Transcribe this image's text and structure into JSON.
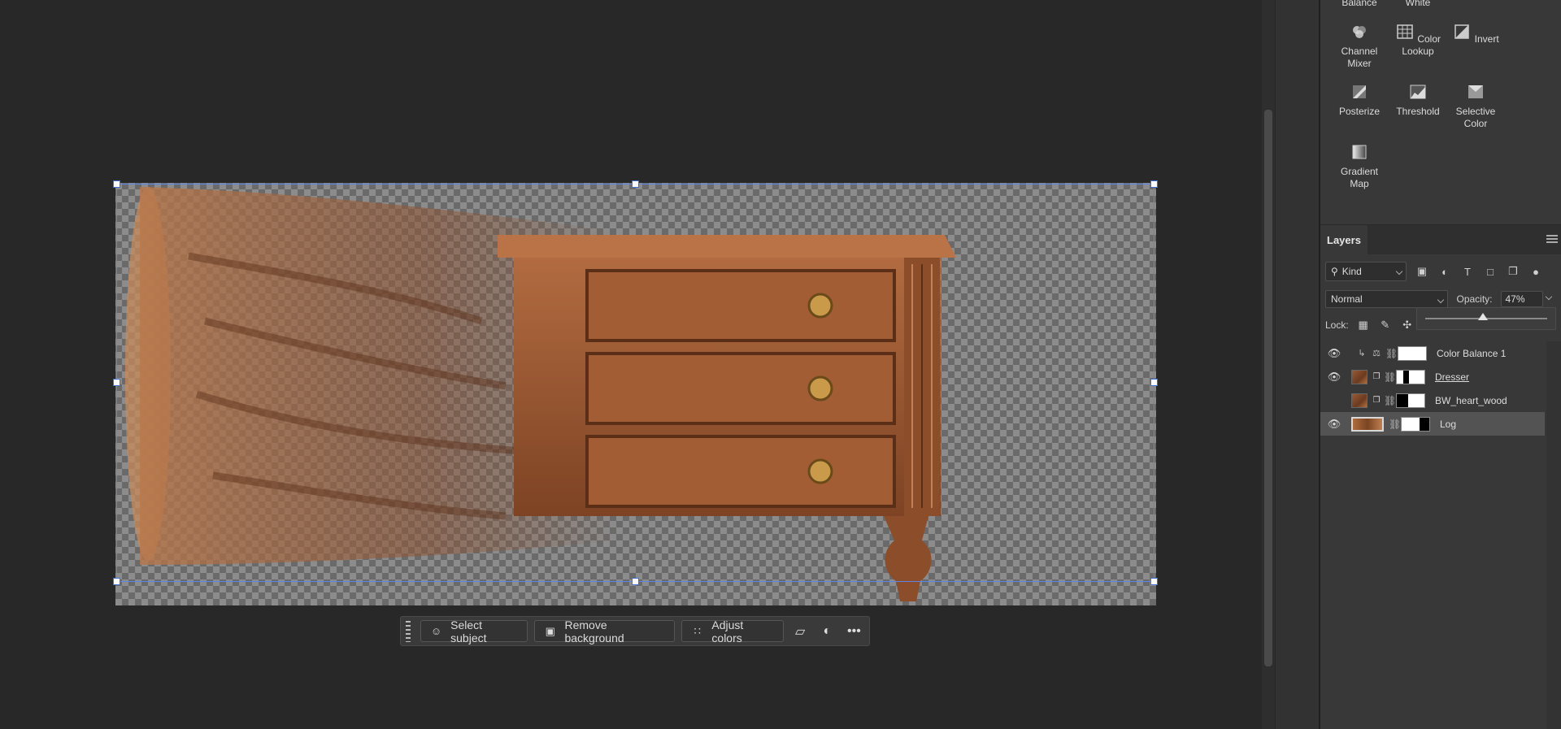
{
  "adjustments": {
    "top_partial": [
      "Balance",
      "White"
    ],
    "items": [
      {
        "label": "Channel Mixer",
        "icon": "channel-mixer-icon"
      },
      {
        "label": "Color Lookup",
        "icon": "color-lookup-icon"
      },
      {
        "label": "Invert",
        "icon": "invert-icon"
      },
      {
        "label": "Posterize",
        "icon": "posterize-icon"
      },
      {
        "label": "Threshold",
        "icon": "threshold-icon"
      },
      {
        "label": "Selective Color",
        "icon": "selective-color-icon"
      },
      {
        "label": "Gradient Map",
        "icon": "gradient-map-icon"
      }
    ]
  },
  "layers_panel": {
    "tab_label": "Layers",
    "filter_kind": "Kind",
    "blend_mode": "Normal",
    "opacity_label": "Opacity:",
    "opacity_value": "47%",
    "opacity_fraction": 0.47,
    "lock_label": "Lock:",
    "layers": [
      {
        "name": "Color Balance 1",
        "visible": true,
        "selected": false
      },
      {
        "name": "Dresser",
        "visible": true,
        "selected": false
      },
      {
        "name": "BW_heart_wood",
        "visible": false,
        "selected": false
      },
      {
        "name": "Log",
        "visible": true,
        "selected": true
      }
    ]
  },
  "taskbar": {
    "select_subject": "Select subject",
    "remove_background": "Remove background",
    "adjust_colors": "Adjust colors"
  },
  "colors": {
    "selection_accent": "#5b86e5",
    "panel_bg": "#383838",
    "canvas_bg": "#282828"
  }
}
